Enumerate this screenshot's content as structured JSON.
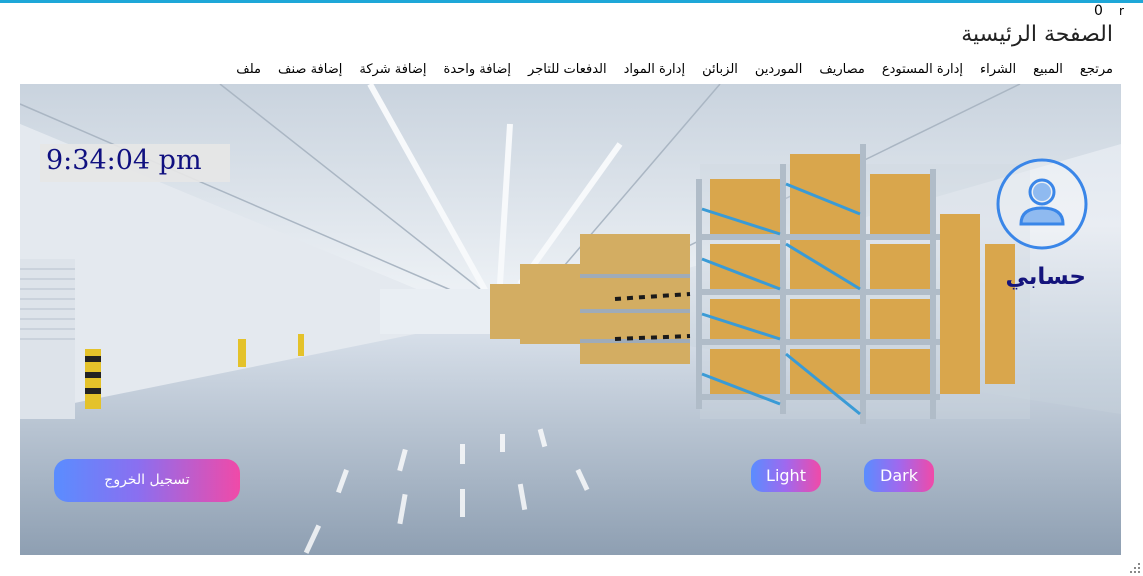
{
  "window": {
    "corner_text_r": "r",
    "corner_text_0": "0"
  },
  "page": {
    "title": "الصفحة الرئيسية"
  },
  "menu": {
    "items": [
      {
        "label": "ملف"
      },
      {
        "label": "إضافة صنف"
      },
      {
        "label": "إضافة شركة"
      },
      {
        "label": "إضافة واحدة"
      },
      {
        "label": "الدفعات للتاجر"
      },
      {
        "label": "إدارة المواد"
      },
      {
        "label": "الزبائن"
      },
      {
        "label": "الموردين"
      },
      {
        "label": "مصاريف"
      },
      {
        "label": "إدارة المستودع"
      },
      {
        "label": "الشراء"
      },
      {
        "label": "المبيع"
      },
      {
        "label": "مرتجع"
      }
    ]
  },
  "hero": {
    "clock": "9:34:04 pm",
    "account_label": "حسابي",
    "avatar_icon": "user-avatar-icon",
    "logout_label": "تسجيل الخروج",
    "light_label": "Light",
    "dark_label": "Dark"
  },
  "colors": {
    "accent_top": "#1ea7d8",
    "clock_text": "#101080",
    "account_text": "#14147c",
    "avatar_ring": "#3a86e8",
    "button_gradient_start": "#5a8dff",
    "button_gradient_end": "#f04aa8"
  }
}
